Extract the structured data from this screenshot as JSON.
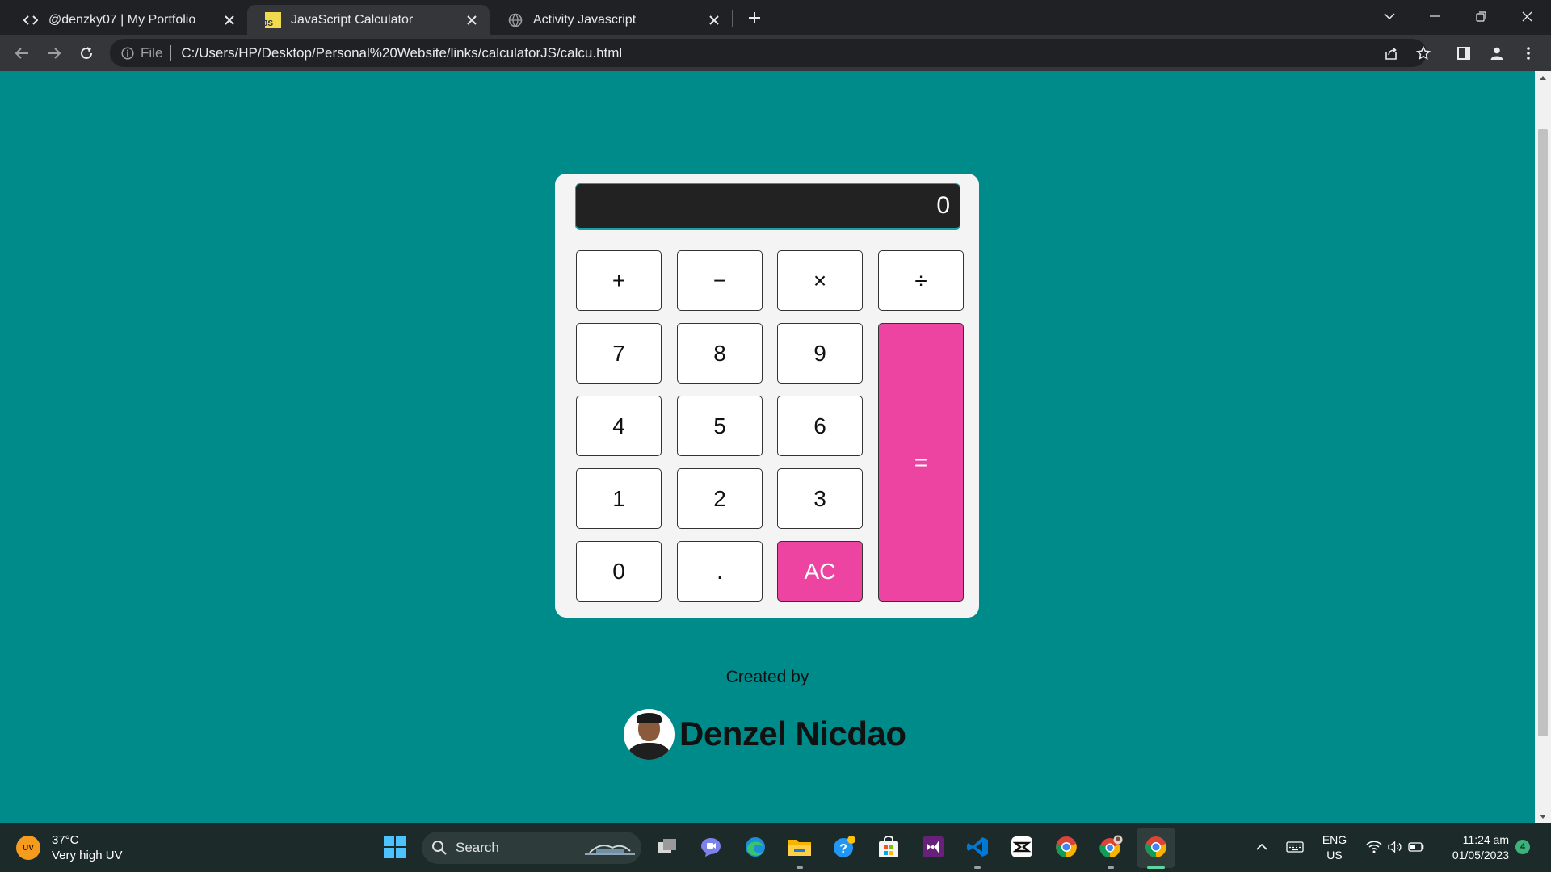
{
  "browser": {
    "tabs": [
      {
        "title": "@denzky07 | My Portfolio",
        "icon": "code-icon",
        "active": false
      },
      {
        "title": "JavaScript Calculator",
        "icon": "js-icon",
        "active": true
      },
      {
        "title": "Activity Javascript",
        "icon": "globe-icon",
        "active": false
      }
    ],
    "address": {
      "scheme_label": "File",
      "url": "C:/Users/HP/Desktop/Personal%20Website/links/calculatorJS/calcu.html"
    },
    "favicon_js_text": "JS"
  },
  "calculator": {
    "display": "0",
    "keys": {
      "plus": "+",
      "minus": "−",
      "times": "×",
      "divide": "÷",
      "seven": "7",
      "eight": "8",
      "nine": "9",
      "four": "4",
      "five": "5",
      "six": "6",
      "one": "1",
      "two": "2",
      "three": "3",
      "zero": "0",
      "dot": ".",
      "clear": "AC",
      "equals": "="
    },
    "accent_color": "#ec44a0",
    "page_background": "#008b8b"
  },
  "credits": {
    "label": "Created by",
    "author": "Denzel Nicdao"
  },
  "taskbar": {
    "weather": {
      "badge": "UV",
      "temp": "37°C",
      "desc": "Very high UV"
    },
    "search_label": "Search",
    "language": {
      "lang": "ENG",
      "region": "US"
    },
    "clock": {
      "time": "11:24 am",
      "date": "01/05/2023"
    },
    "notifications": "4"
  }
}
